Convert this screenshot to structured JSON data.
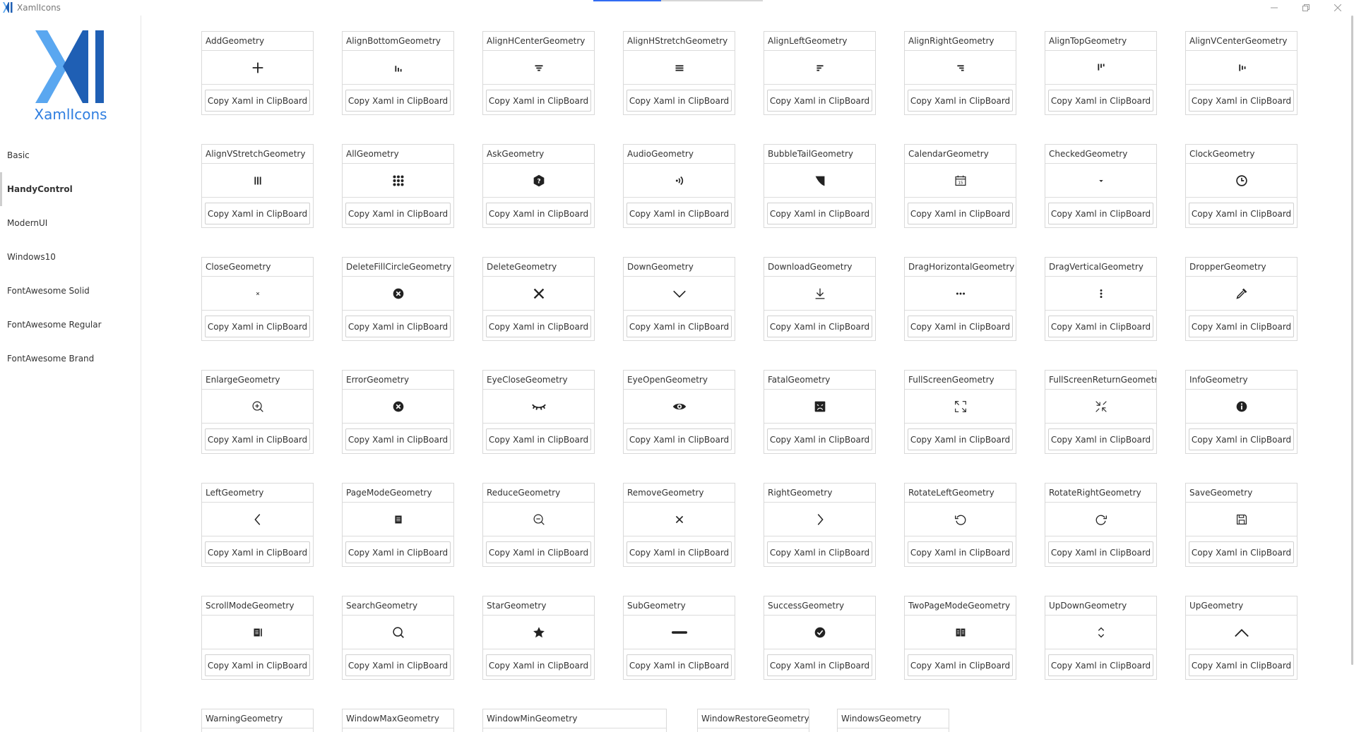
{
  "window": {
    "title": "XamlIcons",
    "minimize_icon": "minimize-icon",
    "restore_icon": "restore-icon",
    "close_icon": "close-icon",
    "progress": 0.4
  },
  "brand": {
    "name": "XamlIcons",
    "logo_color_light": "#5aa7f0",
    "logo_color_dark": "#1f5fb4"
  },
  "sidebar": {
    "items": [
      {
        "label": "Basic",
        "active": false
      },
      {
        "label": "HandyControl",
        "active": true
      },
      {
        "label": "ModernUI",
        "active": false
      },
      {
        "label": "Windows10",
        "active": false
      },
      {
        "label": "FontAwesome Solid",
        "active": false
      },
      {
        "label": "FontAwesome Regular",
        "active": false
      },
      {
        "label": "FontAwesome Brand",
        "active": false
      }
    ]
  },
  "copy_label": "Copy Xaml in ClipBoard",
  "icons": [
    {
      "name": "AddGeometry",
      "icon": "plus"
    },
    {
      "name": "AlignBottomGeometry",
      "icon": "align-bottom"
    },
    {
      "name": "AlignHCenterGeometry",
      "icon": "align-hcenter"
    },
    {
      "name": "AlignHStretchGeometry",
      "icon": "align-hstretch"
    },
    {
      "name": "AlignLeftGeometry",
      "icon": "align-left"
    },
    {
      "name": "AlignRightGeometry",
      "icon": "align-right"
    },
    {
      "name": "AlignTopGeometry",
      "icon": "align-top"
    },
    {
      "name": "AlignVCenterGeometry",
      "icon": "align-vcenter"
    },
    {
      "name": "AlignVStretchGeometry",
      "icon": "align-vstretch"
    },
    {
      "name": "AllGeometry",
      "icon": "grid-dots"
    },
    {
      "name": "AskGeometry",
      "icon": "question-hex"
    },
    {
      "name": "AudioGeometry",
      "icon": "audio"
    },
    {
      "name": "BubbleTailGeometry",
      "icon": "bubble-tail"
    },
    {
      "name": "CalendarGeometry",
      "icon": "calendar"
    },
    {
      "name": "CheckedGeometry",
      "icon": "caret-down"
    },
    {
      "name": "ClockGeometry",
      "icon": "clock"
    },
    {
      "name": "CloseGeometry",
      "icon": "close-small"
    },
    {
      "name": "DeleteFillCircleGeometry",
      "icon": "x-circle"
    },
    {
      "name": "DeleteGeometry",
      "icon": "x-bold"
    },
    {
      "name": "DownGeometry",
      "icon": "chevron-down"
    },
    {
      "name": "DownloadGeometry",
      "icon": "download"
    },
    {
      "name": "DragHorizontalGeometry",
      "icon": "dots-h"
    },
    {
      "name": "DragVerticalGeometry",
      "icon": "dots-v"
    },
    {
      "name": "DropperGeometry",
      "icon": "dropper"
    },
    {
      "name": "EnlargeGeometry",
      "icon": "zoom-in"
    },
    {
      "name": "ErrorGeometry",
      "icon": "x-circle"
    },
    {
      "name": "EyeCloseGeometry",
      "icon": "eye-close"
    },
    {
      "name": "EyeOpenGeometry",
      "icon": "eye-open"
    },
    {
      "name": "FatalGeometry",
      "icon": "fatal"
    },
    {
      "name": "FullScreenGeometry",
      "icon": "fullscreen"
    },
    {
      "name": "FullScreenReturnGeometry",
      "icon": "fullscreen-return"
    },
    {
      "name": "InfoGeometry",
      "icon": "info"
    },
    {
      "name": "LeftGeometry",
      "icon": "chevron-left"
    },
    {
      "name": "PageModeGeometry",
      "icon": "page-mode"
    },
    {
      "name": "ReduceGeometry",
      "icon": "zoom-out"
    },
    {
      "name": "RemoveGeometry",
      "icon": "x-thin"
    },
    {
      "name": "RightGeometry",
      "icon": "chevron-right"
    },
    {
      "name": "RotateLeftGeometry",
      "icon": "rotate-left"
    },
    {
      "name": "RotateRightGeometry",
      "icon": "rotate-right"
    },
    {
      "name": "SaveGeometry",
      "icon": "save"
    },
    {
      "name": "ScrollModeGeometry",
      "icon": "scroll-mode"
    },
    {
      "name": "SearchGeometry",
      "icon": "search"
    },
    {
      "name": "StarGeometry",
      "icon": "star"
    },
    {
      "name": "SubGeometry",
      "icon": "sub-bar"
    },
    {
      "name": "SuccessGeometry",
      "icon": "check-circle"
    },
    {
      "name": "TwoPageModeGeometry",
      "icon": "two-page"
    },
    {
      "name": "UpDownGeometry",
      "icon": "up-down"
    },
    {
      "name": "UpGeometry",
      "icon": "chevron-up"
    },
    {
      "name": "WarningGeometry",
      "icon": "warning"
    },
    {
      "name": "WindowMaxGeometry",
      "icon": "window-max"
    },
    {
      "name": "WindowMinGeometry",
      "icon": "window-min"
    },
    {
      "name": "WindowRestoreGeometry",
      "icon": "window-restore"
    },
    {
      "name": "WindowsGeometry",
      "icon": "windows"
    }
  ]
}
